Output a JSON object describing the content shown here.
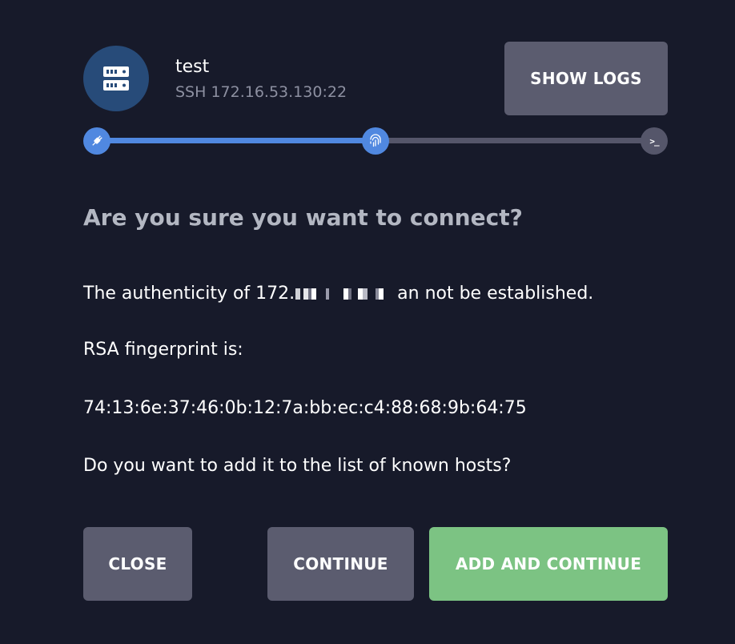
{
  "host": {
    "name": "test",
    "address": "SSH 172.16.53.130:22"
  },
  "toolbar": {
    "show_logs_label": "SHOW LOGS"
  },
  "progress": {
    "completed_fraction": 0.5,
    "steps": [
      "plug-icon",
      "fingerprint-icon",
      "terminal-icon"
    ],
    "terminal_glyph": ">_"
  },
  "dialog": {
    "question": "Are you sure you want to connect?",
    "authenticity_prefix": "The authenticity of 172.",
    "authenticity_suffix": "an not be established.",
    "fingerprint_label": "RSA fingerprint is:",
    "fingerprint": "74:13:6e:37:46:0b:12:7a:bb:ec:c4:88:68:9b:64:75",
    "add_prompt": "Do you want to add it to the list of known hosts?"
  },
  "actions": {
    "close_label": "CLOSE",
    "continue_label": "CONTINUE",
    "add_continue_label": "ADD AND CONTINUE"
  },
  "colors": {
    "background": "#171a2a",
    "accent_blue": "#5088e0",
    "button_gray": "#5b5c6f",
    "button_green": "#7cc383",
    "avatar_blue": "#274b79"
  }
}
